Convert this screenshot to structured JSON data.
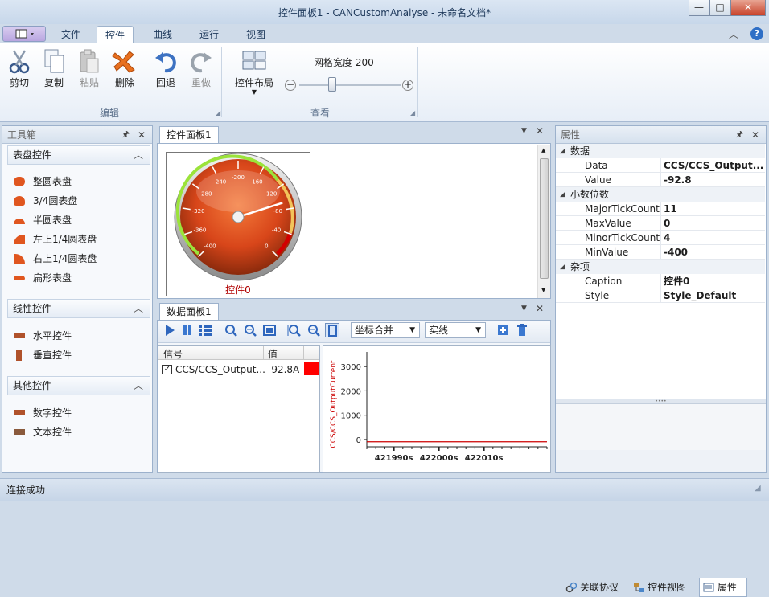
{
  "window": {
    "title": "控件面板1 - CANCustomAnalyse - 未命名文档*",
    "min": "—",
    "max": "□",
    "close": "✕"
  },
  "ribbon": {
    "tabs": [
      "文件",
      "控件",
      "曲线",
      "运行",
      "视图"
    ],
    "active_tab": "控件",
    "edit_group": {
      "label": "编辑",
      "buttons": [
        "剪切",
        "复制",
        "粘贴",
        "删除",
        "回退",
        "重做"
      ]
    },
    "view_group": {
      "label": "查看",
      "layout_button": "控件布局",
      "grid_width_label": "网格宽度 200",
      "grid_width_value": 200
    }
  },
  "toolbox": {
    "title": "工具箱",
    "categories": [
      {
        "name": "表盘控件",
        "items": [
          "整圆表盘",
          "3/4圆表盘",
          "半圆表盘",
          "左上1/4圆表盘",
          "右上1/4圆表盘",
          "扁形表盘"
        ]
      },
      {
        "name": "线性控件",
        "items": [
          "水平控件",
          "垂直控件"
        ]
      },
      {
        "name": "其他控件",
        "items": [
          "数字控件",
          "文本控件"
        ]
      }
    ]
  },
  "control_panel": {
    "tab": "控件面板1",
    "gauge": {
      "caption": "控件0",
      "value": -92.8,
      "min": -400,
      "max": 0,
      "tick_labels": [
        "-400",
        "-360",
        "-320",
        "-280",
        "-240",
        "-200",
        "-160",
        "-120",
        "-80",
        "-40",
        "0"
      ]
    }
  },
  "data_panel": {
    "tab": "数据面板1",
    "combo_axis": "坐标合并",
    "combo_line": "实线",
    "table": {
      "headers": [
        "信号",
        "值",
        ""
      ],
      "rows": [
        {
          "checked": true,
          "signal": "CCS/CCS_Output...",
          "value": "-92.8A",
          "color": "#ff0000"
        }
      ]
    }
  },
  "chart_data": {
    "type": "line",
    "title": "",
    "ylabel": "CCS/CCS_OutputCurrent",
    "xlabel": "",
    "y_ticks": [
      "0",
      "1000",
      "2000",
      "3000"
    ],
    "x_ticks": [
      "421990s",
      "422000s",
      "422010s"
    ],
    "ylim": [
      -300,
      3600
    ],
    "xlim": [
      421984,
      422024
    ],
    "series": [
      {
        "name": "CCS/CCS_OutputCurrent",
        "x": [
          421984,
          422024
        ],
        "y": [
          -92.8,
          -92.8
        ],
        "color": "#cc0000"
      }
    ]
  },
  "properties": {
    "title": "属性",
    "sections": [
      {
        "name": "数据",
        "rows": [
          {
            "key": "Data",
            "value": "CCS/CCS_Output..."
          },
          {
            "key": "Value",
            "value": "-92.8"
          }
        ]
      },
      {
        "name": "小数位数",
        "rows": [
          {
            "key": "MajorTickCount",
            "value": "11"
          },
          {
            "key": "MaxValue",
            "value": "0"
          },
          {
            "key": "MinorTickCount",
            "value": "4"
          },
          {
            "key": "MinValue",
            "value": "-400"
          }
        ]
      },
      {
        "name": "杂项",
        "rows": [
          {
            "key": "Caption",
            "value": "控件0"
          },
          {
            "key": "Style",
            "value": "Style_Default"
          }
        ]
      }
    ],
    "bottom_tabs": [
      "关联协议",
      "控件视图",
      "属性"
    ],
    "active_bottom_tab": "属性"
  },
  "status": {
    "text": "连接成功"
  }
}
